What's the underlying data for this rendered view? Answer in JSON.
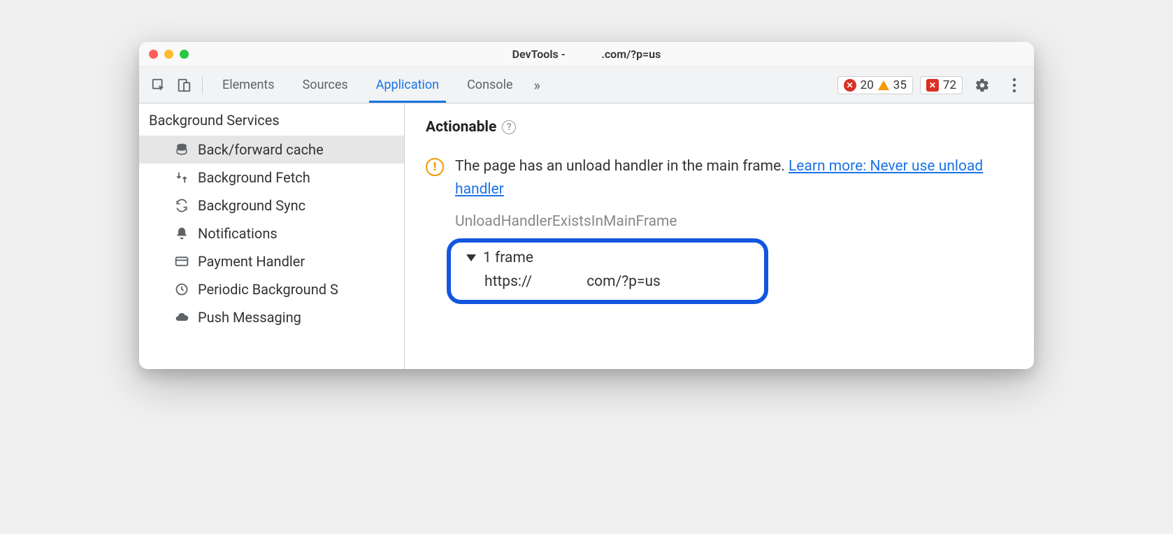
{
  "window": {
    "title": "DevTools -             .com/?p=us"
  },
  "toolbar": {
    "tabs": [
      "Elements",
      "Sources",
      "Application",
      "Console"
    ],
    "active_index": 2,
    "errors": "20",
    "warnings": "35",
    "issues": "72"
  },
  "sidebar": {
    "heading": "Background Services",
    "items": [
      "Back/forward cache",
      "Background Fetch",
      "Background Sync",
      "Notifications",
      "Payment Handler",
      "Periodic Background S",
      "Push Messaging"
    ],
    "selected_index": 0
  },
  "main": {
    "section_title": "Actionable",
    "issue_text": "The page has an unload handler in the main frame. ",
    "issue_link": "Learn more: Never use unload handler",
    "reason_name": "UnloadHandlerExistsInMainFrame",
    "frame_header": "1 frame",
    "frame_url": "https://               com/?p=us"
  }
}
